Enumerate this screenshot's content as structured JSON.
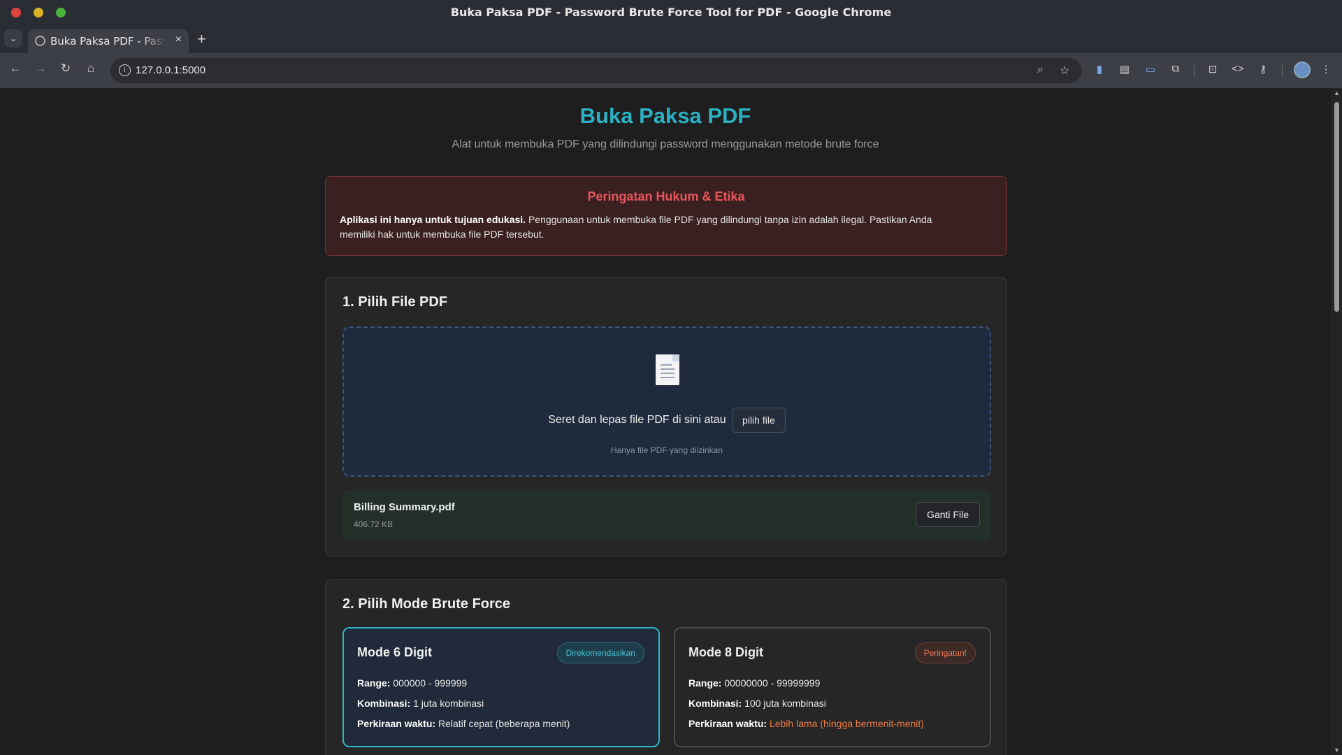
{
  "window": {
    "title": "Buka Paksa PDF - Password Brute Force Tool for PDF - Google Chrome"
  },
  "tab": {
    "title": "Buka Paksa PDF - Password Brute Force Tool for PDF",
    "close": "×",
    "new": "+"
  },
  "address": {
    "url": "127.0.0.1:5000"
  },
  "page": {
    "title": "Buka Paksa PDF",
    "subtitle": "Alat untuk membuka PDF yang dilindungi password menggunakan metode brute force"
  },
  "warning": {
    "title": "Peringatan Hukum & Etika",
    "bold": "Aplikasi ini hanya untuk tujuan edukasi.",
    "text": " Penggunaan untuk membuka file PDF yang dilindungi tanpa izin adalah ilegal. Pastikan Anda memiliki hak untuk membuka file PDF tersebut."
  },
  "step1": {
    "title": "1. Pilih File PDF",
    "drop_text": "Seret dan lepas file PDF di sini atau",
    "pick_button": "pilih file",
    "hint": "Hanya file PDF yang diizinkan",
    "file_name": "Billing Summary.pdf",
    "file_size": "406.72 KB",
    "change_button": "Ganti File"
  },
  "step2": {
    "title": "2. Pilih Mode Brute Force",
    "modes": [
      {
        "title": "Mode 6 Digit",
        "badge": "Direkomendasikan",
        "range_label": "Range:",
        "range": "000000 - 999999",
        "combo_label": "Kombinasi:",
        "combo": "1 juta kombinasi",
        "time_label": "Perkiraan waktu:",
        "time": "Relatif cepat (beberapa menit)"
      },
      {
        "title": "Mode 8 Digit",
        "badge": "Peringatan!",
        "range_label": "Range:",
        "range": "00000000 - 99999999",
        "combo_label": "Kombinasi:",
        "combo": "100 juta kombinasi",
        "time_label": "Perkiraan waktu:",
        "time": "Lebih lama (hingga bermenit-menit)"
      }
    ]
  },
  "colors": {
    "accent": "#2bb1c3",
    "danger": "#e8555a",
    "warn": "#f07a45"
  }
}
